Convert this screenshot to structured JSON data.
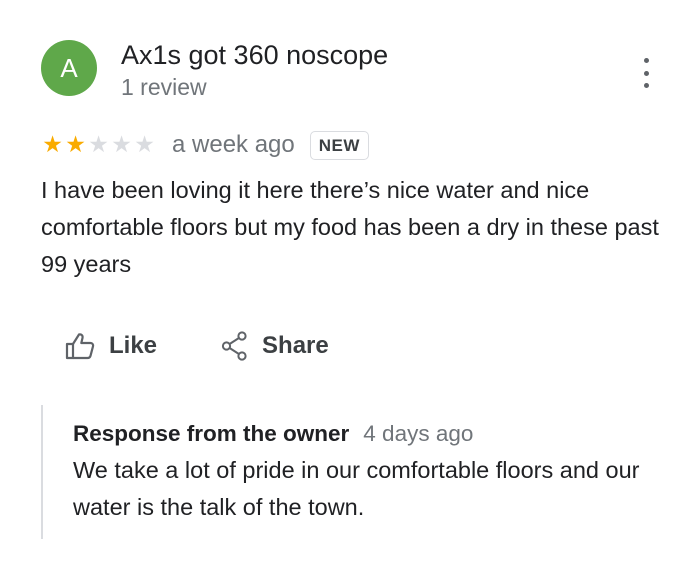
{
  "reviewer": {
    "avatar_letter": "A",
    "name": "Ax1s got 360 noscope",
    "subtitle": "1 review"
  },
  "rating": {
    "stars_filled": 2,
    "stars_total": 5,
    "date": "a week ago",
    "badge": "NEW"
  },
  "review": {
    "text": "I have been loving it here there’s nice water and nice comfortable floors but my food has been a dry in these past 99 years"
  },
  "actions": {
    "like_label": "Like",
    "share_label": "Share"
  },
  "owner_response": {
    "title": "Response from the owner",
    "date": "4 days ago",
    "text": "We take a lot of pride in our comfortable floors and our water is the talk of the town."
  },
  "colors": {
    "avatar": "#5fa84a",
    "star_filled": "#f9ab00",
    "star_empty": "#dadce0",
    "secondary_text": "#70757a"
  },
  "icons": {
    "more": "more-vert-icon",
    "like": "thumb-up-outline-icon",
    "share": "share-icon",
    "star": "star-icon"
  }
}
